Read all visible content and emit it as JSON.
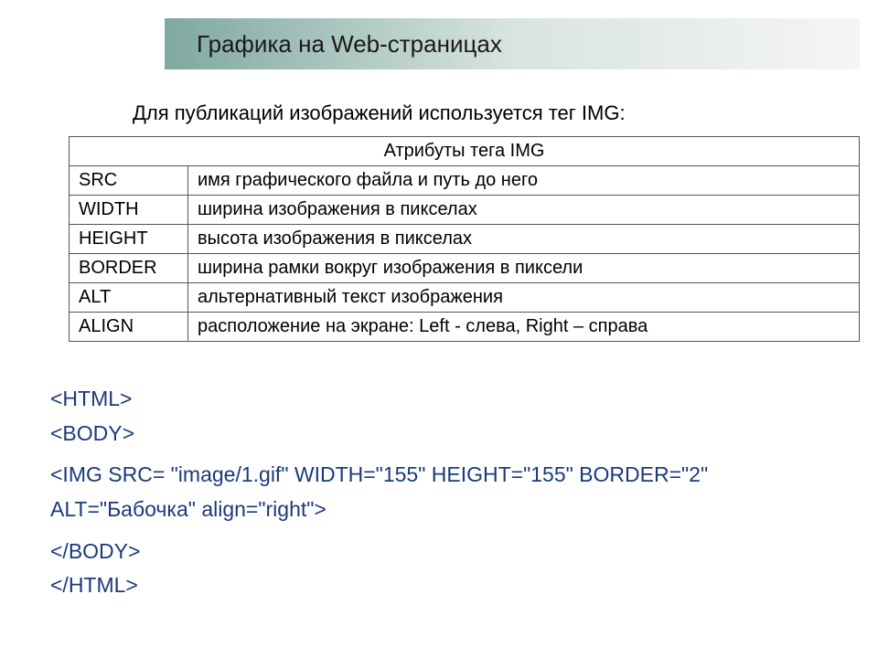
{
  "title": "Графика на Web-страницах",
  "intro": "Для публикаций изображений используется тег IMG:",
  "table": {
    "header": "Атрибуты тега IMG",
    "rows": [
      {
        "attr": "SRC",
        "desc": "имя графического файла и путь до него"
      },
      {
        "attr": "WIDTH",
        "desc": "ширина изображения в пикселах"
      },
      {
        "attr": "HEIGHT",
        "desc": "высота изображения в пикселах"
      },
      {
        "attr": "BORDER",
        "desc": "ширина рамки вокруг изображения в пиксели"
      },
      {
        "attr": "ALT",
        "desc": "альтернативный текст изображения"
      },
      {
        "attr": "ALIGN",
        "desc": "расположение на экране: Left - слева, Right – справа"
      }
    ]
  },
  "code": {
    "line1": "<HTML>",
    "line2": "<BODY>",
    "line3": "<IMG SRC= \"image/1.gif\" WIDTH=\"155\" HEIGHT=\"155\" BORDER=\"2\"",
    "line4": "ALT=\"Бабочка\" align=\"right\">",
    "line5": "</BODY>",
    "line6": "</HTML>"
  }
}
